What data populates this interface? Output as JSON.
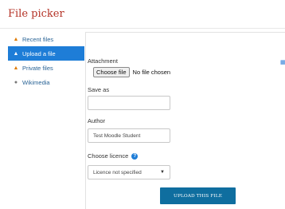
{
  "dialog": {
    "title": "File picker"
  },
  "sidebar": {
    "items": [
      {
        "label": "Recent files",
        "icon": "recent-files-icon"
      },
      {
        "label": "Upload a file",
        "icon": "upload-icon",
        "active": true
      },
      {
        "label": "Private files",
        "icon": "private-files-icon"
      },
      {
        "label": "Wikimedia",
        "icon": "wikimedia-icon"
      }
    ]
  },
  "form": {
    "attachment_label": "Attachment",
    "choose_file_label": "Choose file",
    "file_status": "No file chosen",
    "save_as_label": "Save as",
    "save_as_value": "",
    "author_label": "Author",
    "author_value": "Test Moodle Student",
    "licence_label": "Choose licence",
    "licence_selected": "Licence not specified",
    "upload_label": "UPLOAD THIS FILE"
  },
  "colors": {
    "title": "#b43226",
    "accent": "#1e7dd7",
    "upload_button": "#0f6e9f"
  }
}
